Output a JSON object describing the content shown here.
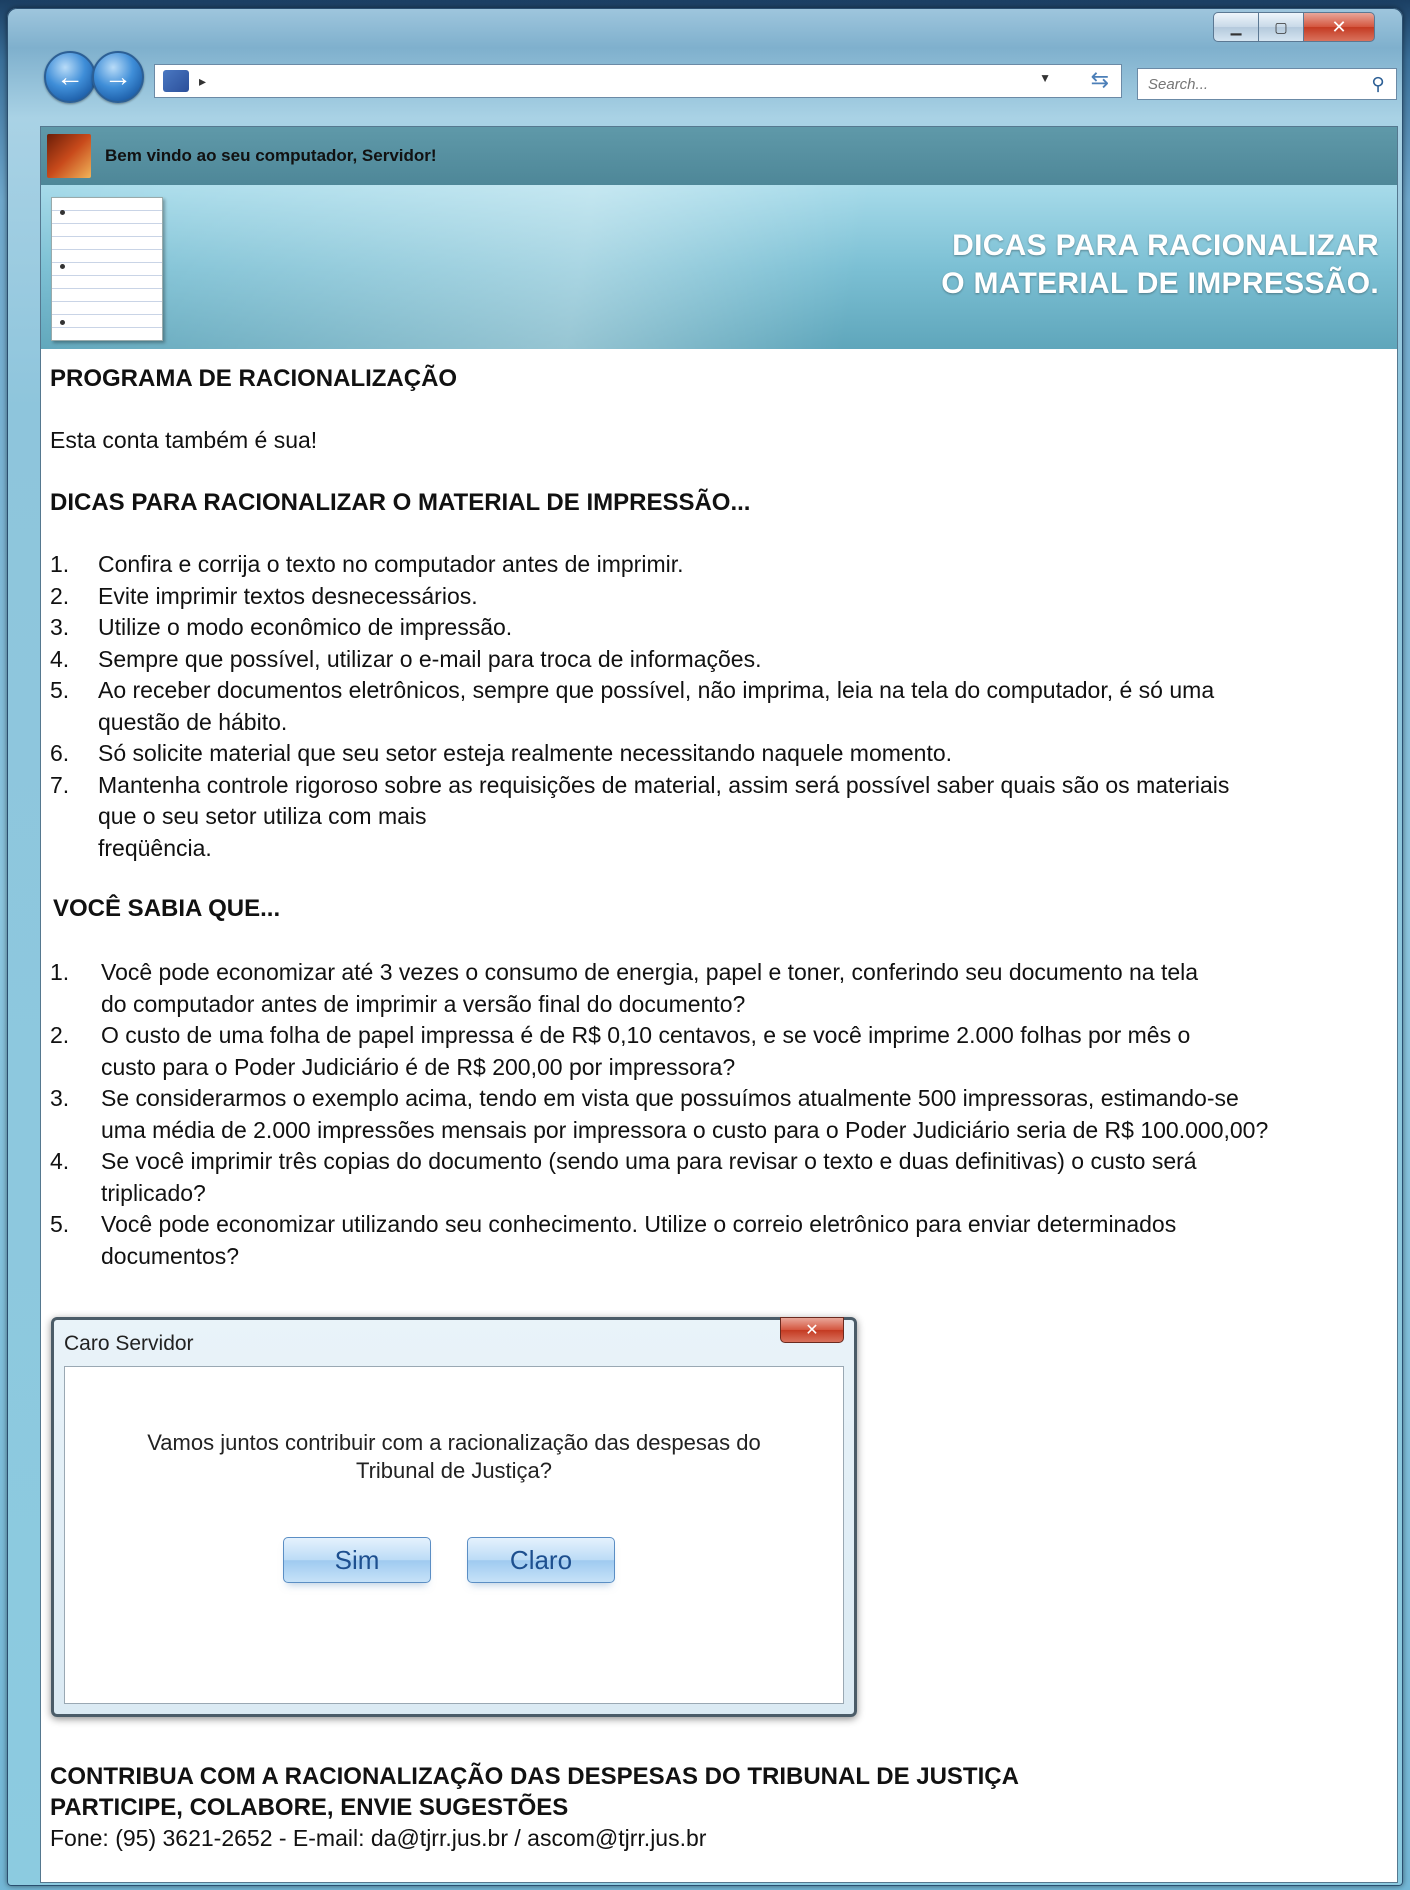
{
  "browser": {
    "search_placeholder": "Search..."
  },
  "banner": {
    "welcome": "Bem vindo ao seu computador, Servidor!",
    "title_line1": "DICAS PARA RACIONALIZAR",
    "title_line2": "O MATERIAL DE IMPRESSÃO."
  },
  "doc": {
    "heading1": "PROGRAMA DE RACIONALIZAÇÃO",
    "subtitle": "Esta conta também é sua!",
    "heading2": "DICAS PARA RACIONALIZAR O MATERIAL DE IMPRESSÃO...",
    "tips": [
      {
        "num": "1.",
        "lines": [
          "Confira e corrija o texto no computador antes de imprimir."
        ]
      },
      {
        "num": "2.",
        "lines": [
          "Evite imprimir textos desnecessários."
        ]
      },
      {
        "num": "3.",
        "lines": [
          "Utilize o modo econômico de impressão."
        ]
      },
      {
        "num": "4.",
        "lines": [
          "Sempre que possível, utilizar o e-mail para troca de informações."
        ]
      },
      {
        "num": "5.",
        "lines": [
          "Ao receber documentos eletrônicos, sempre que possível, não imprima, leia na tela do computador, é só uma",
          "questão de hábito."
        ]
      },
      {
        "num": "6.",
        "lines": [
          "Só solicite material que seu setor esteja realmente necessitando naquele momento."
        ]
      },
      {
        "num": "7.",
        "lines": [
          "Mantenha controle rigoroso sobre as requisições de material, assim será possível saber quais são os materiais",
          "que o seu setor utiliza com mais",
          "freqüência."
        ]
      }
    ],
    "heading3": "VOCÊ SABIA QUE...",
    "facts": [
      {
        "num": "1.",
        "lines": [
          "Você pode economizar até 3 vezes o consumo de energia, papel e toner, conferindo seu documento na tela",
          "do computador antes de imprimir a versão final do documento?"
        ]
      },
      {
        "num": "2.",
        "lines": [
          "O custo de uma folha de papel impressa é de R$ 0,10 centavos, e se você imprime 2.000 folhas por mês o",
          "custo para o Poder Judiciário é de R$ 200,00 por impressora?"
        ]
      },
      {
        "num": "3.",
        "lines": [
          "Se considerarmos o exemplo acima, tendo em vista que possuímos atualmente 500 impressoras, estimando-se",
          "uma média de 2.000 impressões mensais por impressora o custo para o Poder Judiciário seria de R$ 100.000,00?"
        ]
      },
      {
        "num": "4.",
        "lines": [
          "Se você imprimir três copias do documento (sendo uma para revisar o texto e duas definitivas) o custo será",
          "triplicado?"
        ]
      },
      {
        "num": "5.",
        "lines": [
          "Você pode economizar utilizando seu conhecimento. Utilize o correio eletrônico para enviar determinados",
          "documentos?"
        ]
      }
    ]
  },
  "dialog": {
    "title": "Caro Servidor",
    "message_line1": "Vamos juntos contribuir com a racionalização das despesas do",
    "message_line2": "Tribunal de Justiça?",
    "button_yes": "Sim",
    "button_sure": "Claro"
  },
  "footer": {
    "line1": "CONTRIBUA COM A RACIONALIZAÇÃO DAS DESPESAS DO TRIBUNAL DE JUSTIÇA",
    "line2": "PARTICIPE, COLABORE, ENVIE SUGESTÕES",
    "line3": "Fone: (95) 3621-2652 - E-mail: da@tjrr.jus.br / ascom@tjrr.jus.br"
  }
}
